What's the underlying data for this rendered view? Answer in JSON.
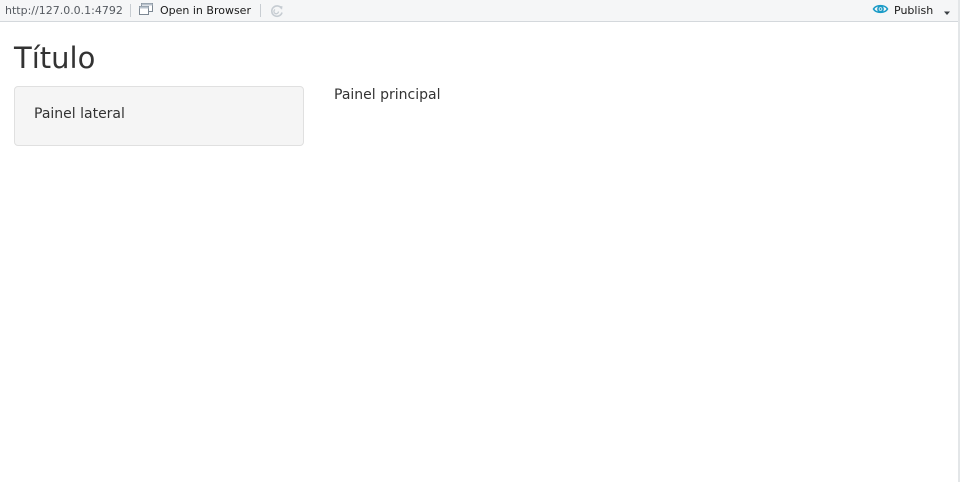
{
  "toolbar": {
    "url": "http://127.0.0.1:4792",
    "open_in_browser_label": "Open in Browser",
    "publish_label": "Publish",
    "accent_color": "#1a9bc7"
  },
  "icons": {
    "open_in_browser": "open-in-browser-icon",
    "refresh": "refresh-icon",
    "publish": "publish-icon",
    "caret": "chevron-down-icon"
  },
  "app": {
    "title": "Título",
    "sidebar_text": "Painel lateral",
    "main_text": "Painel principal"
  }
}
